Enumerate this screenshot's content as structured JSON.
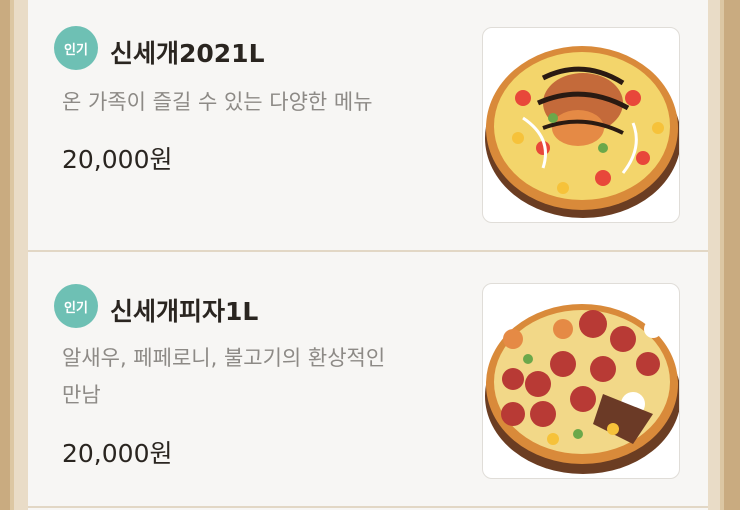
{
  "menu": {
    "items": [
      {
        "badge": "인기",
        "name": "신세개2021L",
        "description": "온 가족이 즐길 수 있는 다양한 메뉴",
        "price": "20,000원",
        "image": "pizza-seafood-icon"
      },
      {
        "badge": "인기",
        "name": "신세개피자1L",
        "description_line1": "알새우, 페페로니, 불고기의 환상적인",
        "description_line2": "만남",
        "price": "20,000원",
        "image": "pizza-pepperoni-icon"
      }
    ]
  },
  "colors": {
    "badge": "#6ec0b4",
    "frame": "#c9ab80",
    "paper": "#f7f6f4",
    "text": "#2a2520",
    "muted": "#8d8a86"
  }
}
